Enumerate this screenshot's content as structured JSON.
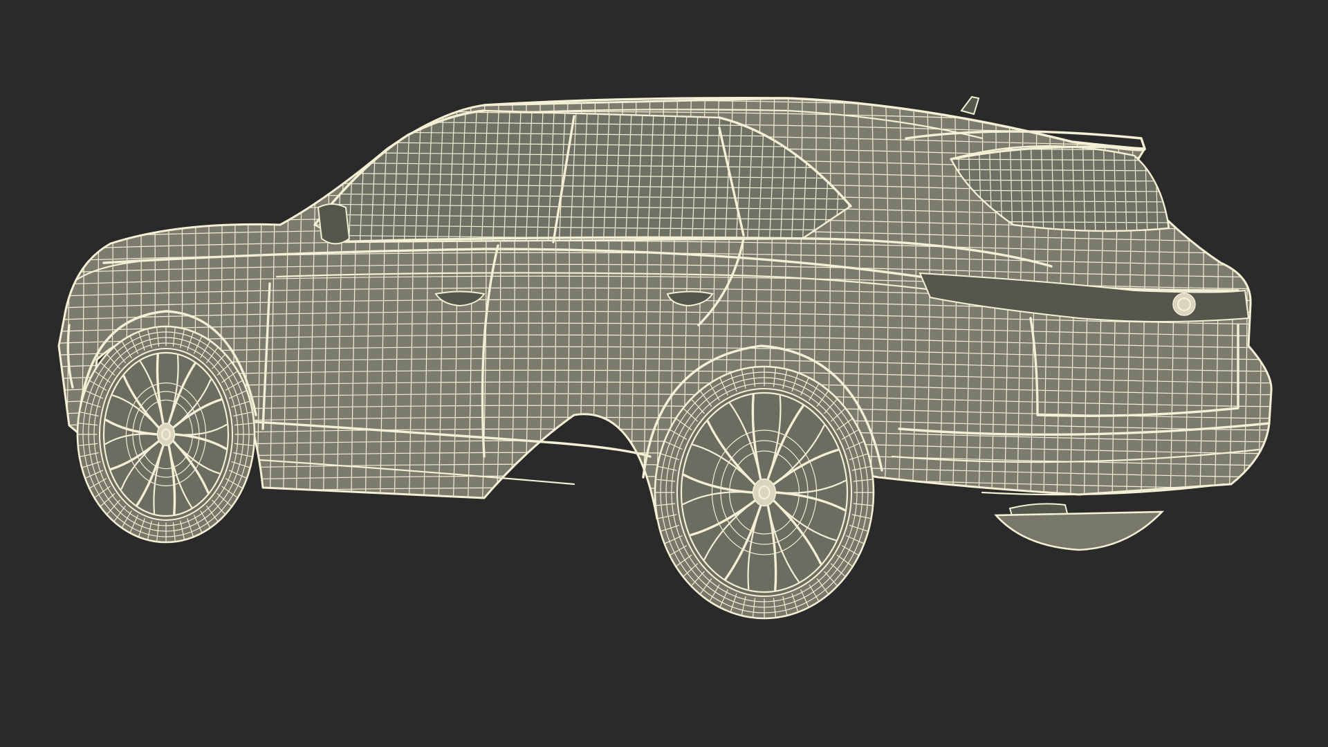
{
  "scene": {
    "subject": "suv-wireframe-model",
    "background_color": "#2a2a2a",
    "mesh_color": "#7b7c6e",
    "wire_color": "#f3f0d6"
  }
}
